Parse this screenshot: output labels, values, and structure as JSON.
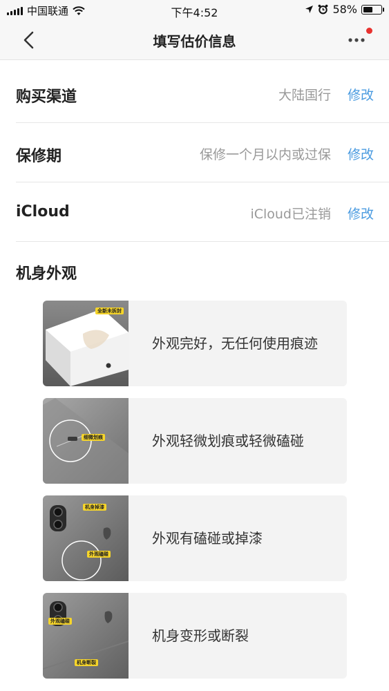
{
  "status_bar": {
    "carrier": "中国联通",
    "time": "下午4:52",
    "battery_percent": "58%",
    "battery_level": 0.58,
    "icons": [
      "signal-icon",
      "wifi-icon",
      "location-icon",
      "alarm-icon",
      "battery-icon"
    ]
  },
  "nav": {
    "title": "填写估价信息",
    "back_icon": "chevron-left-icon",
    "more_icon": "more-icon",
    "notification_dot_color": "#e8322f"
  },
  "rows": [
    {
      "label": "购买渠道",
      "value": "大陆国行",
      "action": "修改"
    },
    {
      "label": "保修期",
      "value": "保修一个月以内或过保",
      "action": "修改"
    },
    {
      "label": "iCloud",
      "value": "iCloud已注销",
      "action": "修改"
    }
  ],
  "appearance": {
    "title": "机身外观",
    "options": [
      {
        "text": "外观完好，无任何使用痕迹",
        "tags": [
          "全新未拆封"
        ]
      },
      {
        "text": "外观轻微划痕或轻微磕碰",
        "tags": [
          "细微划痕"
        ]
      },
      {
        "text": "外观有磕碰或掉漆",
        "tags": [
          "机身掉漆",
          "外观磕碰"
        ]
      },
      {
        "text": "机身变形或断裂",
        "tags": [
          "外观磕碰",
          "机身断裂"
        ]
      }
    ]
  },
  "colors": {
    "accent": "#4a9be0",
    "value_text": "#999999",
    "tag_yellow": "#f6d52a"
  }
}
